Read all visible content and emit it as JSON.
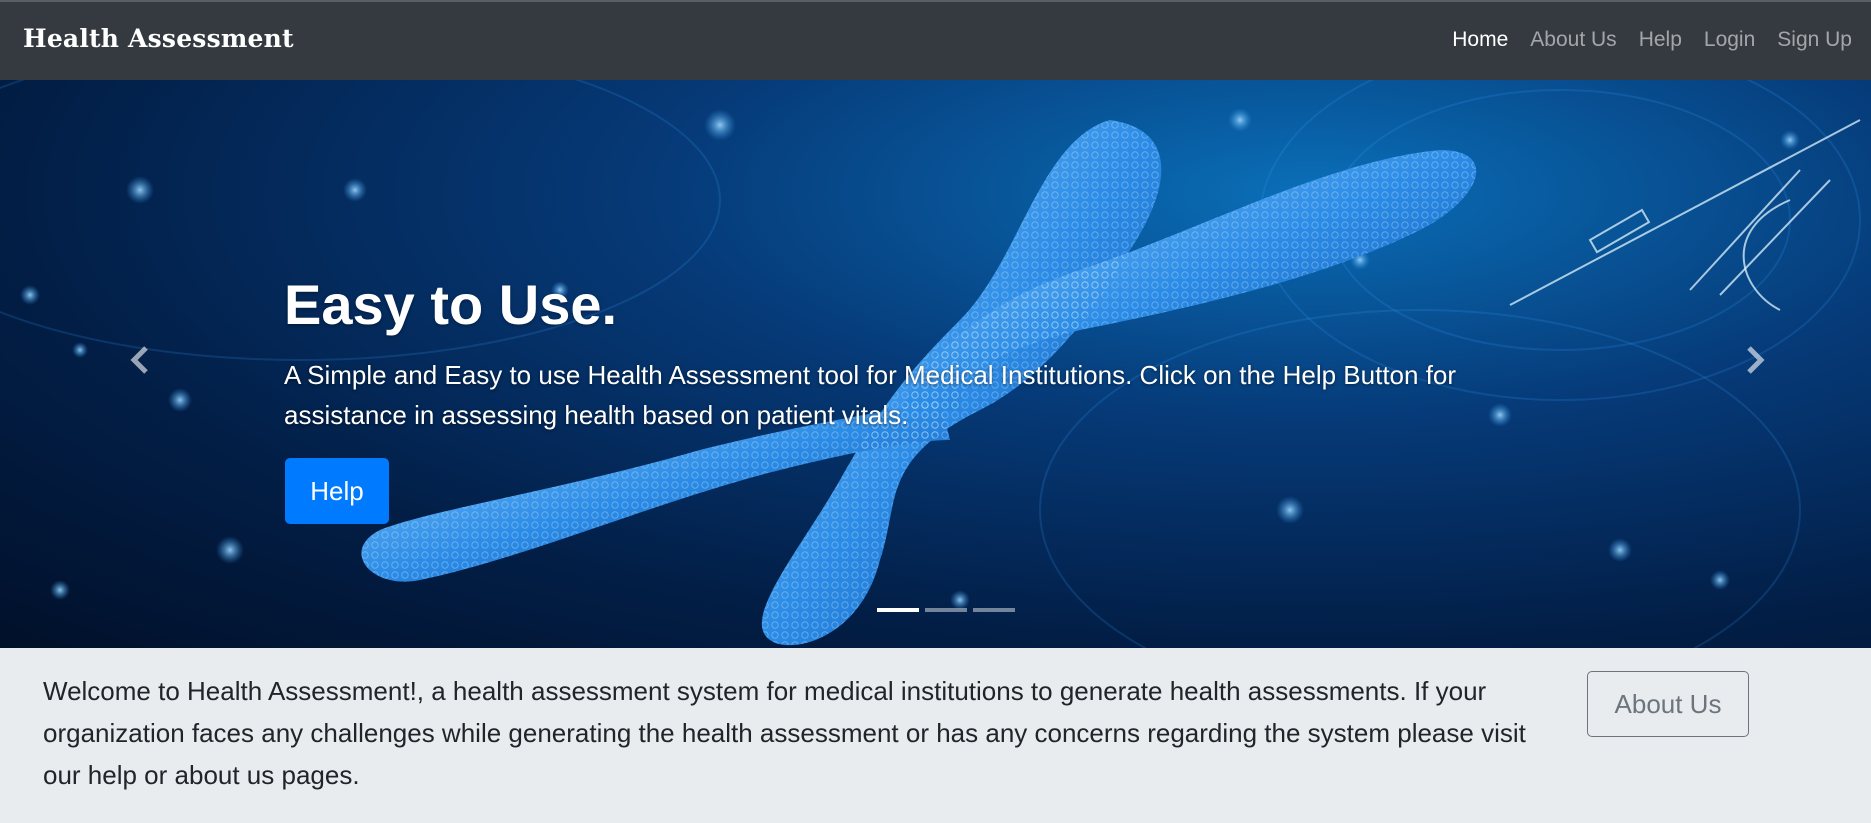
{
  "navbar": {
    "brand": "Health Assessment",
    "links": [
      {
        "label": "Home",
        "active": true
      },
      {
        "label": "About Us",
        "active": false
      },
      {
        "label": "Help",
        "active": false
      },
      {
        "label": "Login",
        "active": false
      },
      {
        "label": "Sign Up",
        "active": false
      }
    ]
  },
  "hero": {
    "title": "Easy to Use.",
    "text": "A Simple and Easy to use Health Assessment tool for Medical Institutions. Click on the Help Button for assistance in assessing health based on patient vitals.",
    "button_label": "Help",
    "slides_count": 3,
    "active_slide": 1,
    "prev_icon": "chevron-left-icon",
    "next_icon": "chevron-right-icon"
  },
  "welcome": {
    "text": "Welcome to Health Assessment!, a health assessment system for medical institutions to generate health assessments. If your organization faces any challenges while generating the health assessment or has any concerns regarding the system please visit our help or about us pages.",
    "button_label": "About Us"
  },
  "colors": {
    "navbar_bg": "#343a40",
    "primary": "#007bff",
    "secondary": "#6c757d",
    "band_bg": "#e9ecef"
  }
}
